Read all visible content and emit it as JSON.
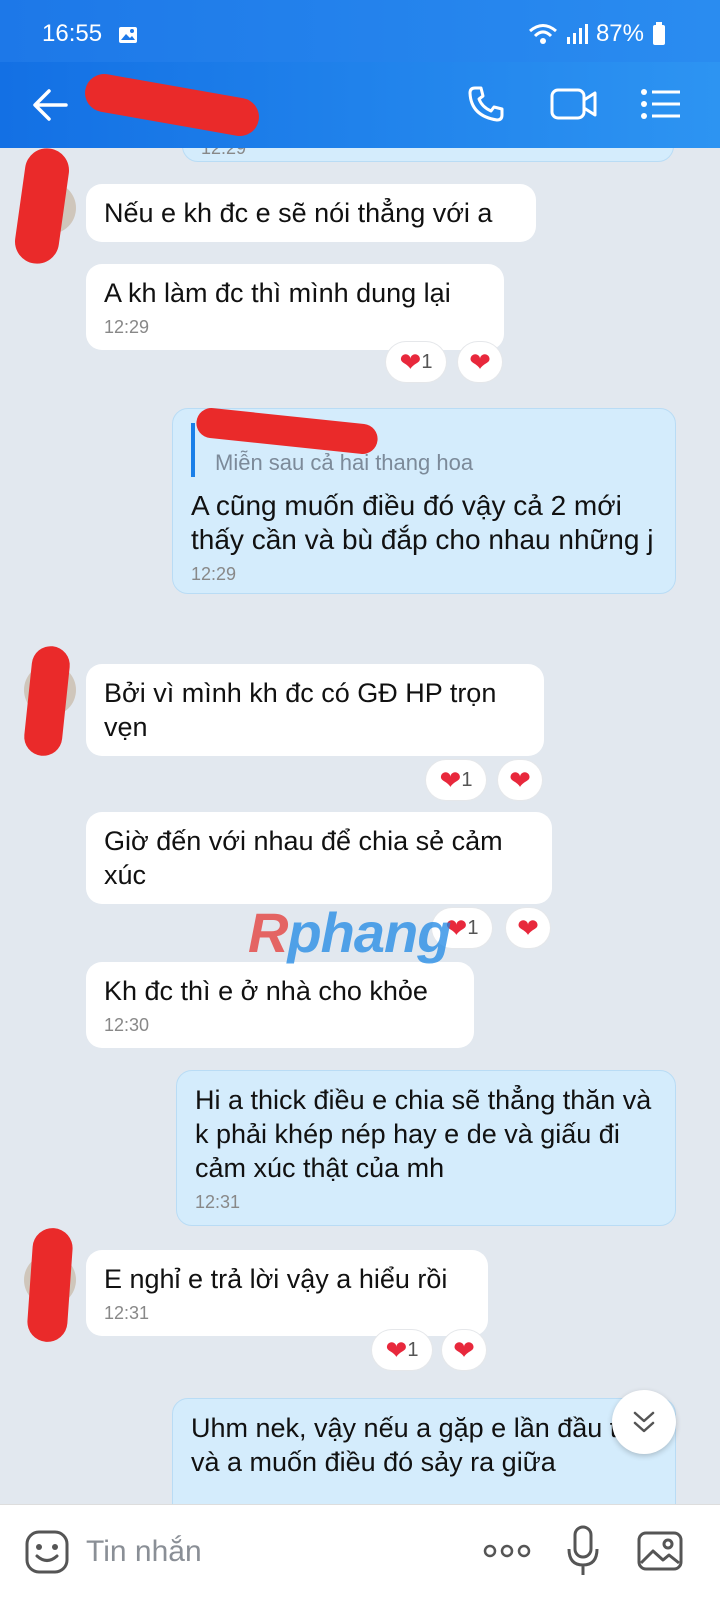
{
  "status_bar": {
    "time": "16:55",
    "battery": "87%"
  },
  "header": {
    "back_label": "←"
  },
  "messages": [
    {
      "text": "12:29"
    },
    {
      "text": "Nếu e kh đc e sẽ nói thẳng với a"
    },
    {
      "text": "A kh làm đc thì mình dung lại",
      "time": "12:29",
      "reaction_count": "1"
    },
    {
      "reply_text": "Miễn sau cả hai thang hoa",
      "text": "A cũng muốn điều đó vậy cả 2 mới thấy cần và bù đắp cho nhau những j",
      "time": "12:29"
    },
    {
      "text": "Bởi vì mình kh đc có GĐ HP trọn vẹn",
      "reaction_count": "1"
    },
    {
      "text": "Giờ đến với nhau để chia sẻ cảm xúc",
      "reaction_count": "1"
    },
    {
      "text": "Kh đc thì e ở nhà cho khỏe",
      "time": "12:30"
    },
    {
      "text": "Hi a thick điều e chia sẽ thẳng thăn và k phải khép nép hay e de và giấu đi cảm xúc thật của mh",
      "time": "12:31"
    },
    {
      "text": "E nghỉ e trả lời vậy a hiểu rồi",
      "time": "12:31",
      "reaction_count": "1"
    },
    {
      "text": "Uhm nek, vậy nếu a gặp e lần đầu tiên và a muốn điều đó sảy ra giữa"
    }
  ],
  "watermark": {
    "r": "R",
    "rest": "phang"
  },
  "input": {
    "placeholder": "Tin nhắn"
  },
  "colors": {
    "header": "#1a7fe8",
    "outgoing_bubble": "#d4ecfc",
    "heart": "#e8283c",
    "redaction": "#ea2a2a"
  }
}
